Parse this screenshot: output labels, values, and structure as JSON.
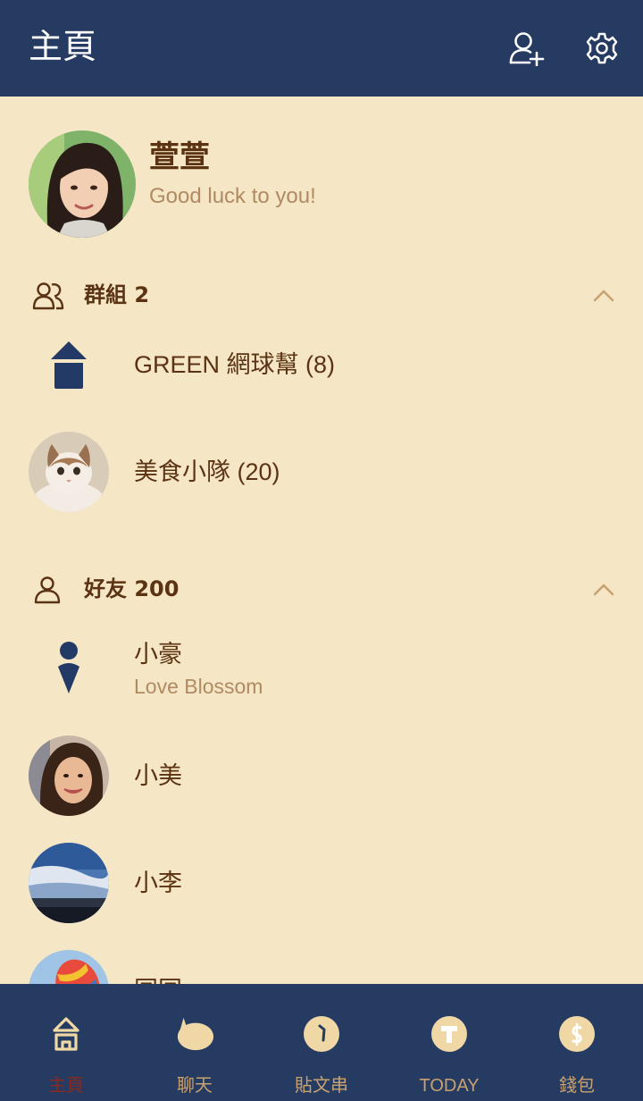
{
  "header": {
    "title": "主頁",
    "add_friend_icon": "add-friend-icon",
    "settings_icon": "gear-icon"
  },
  "profile": {
    "name": "萱萱",
    "status": "Good luck to you!"
  },
  "groups": {
    "label": "群組 2",
    "items": [
      {
        "label": "GREEN 網球幫 (8)",
        "avatar": "group-placeholder-icon"
      },
      {
        "label": "美食小隊 (20)",
        "avatar": "cat-photo"
      }
    ]
  },
  "friends": {
    "label": "好友 200",
    "items": [
      {
        "name": "小豪",
        "status": "Love Blossom",
        "avatar": "person-placeholder-icon"
      },
      {
        "name": "小美",
        "avatar": "woman-photo"
      },
      {
        "name": "小李",
        "avatar": "sky-photo"
      },
      {
        "name": "囝囝",
        "avatar": "balloon-photo"
      }
    ]
  },
  "tabs": [
    {
      "label": "主頁",
      "icon": "home-icon",
      "active": true
    },
    {
      "label": "聊天",
      "icon": "chat-icon",
      "active": false
    },
    {
      "label": "貼文串",
      "icon": "timeline-icon",
      "active": false
    },
    {
      "label": "TODAY",
      "icon": "today-icon",
      "active": false
    },
    {
      "label": "錢包",
      "icon": "wallet-icon",
      "active": false
    }
  ],
  "colors": {
    "header_bg": "#263b62",
    "page_bg": "#f5e6c6",
    "text": "#5b3312",
    "subtext": "#b08a63",
    "tab_label": "#c8a170",
    "tab_active": "#8b2a1e",
    "icon_blue": "#243a66"
  }
}
